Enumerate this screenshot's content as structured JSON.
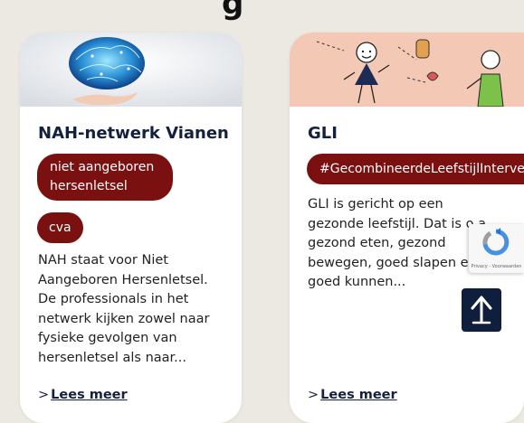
{
  "page": {
    "heading_partial": "g"
  },
  "cards": [
    {
      "title": "NAH-netwerk Vianen",
      "tags": [
        "niet aangeboren\nhersenletsel",
        "cva"
      ],
      "description": "NAH staat voor Niet\nAangeboren Hersenletsel.\nDe professionals in het\nnetwerk kijken zowel naar\nfysieke gevolgen van\nhersenletsel als naar...",
      "link": "Lees meer",
      "image_icon": "brain-hand-icon"
    },
    {
      "title": "GLI",
      "tags": [
        "#GecombineerdeLeefstijlInterventie"
      ],
      "description": "GLI is gericht op een\ngezonde leefstijl. Dat is o a\ngezond eten, gezond\nbewegen, goed slapen en\ngoed kunnen...",
      "link": "Lees meer",
      "image_icon": "lifestyle-illustration-icon"
    }
  ],
  "recaptcha": {
    "text": "Privacy - Voorwaarden"
  },
  "colors": {
    "tag": "#7b1010",
    "title": "#13213f",
    "background": "#ece8e2",
    "scroll_button": "#101e3d"
  }
}
